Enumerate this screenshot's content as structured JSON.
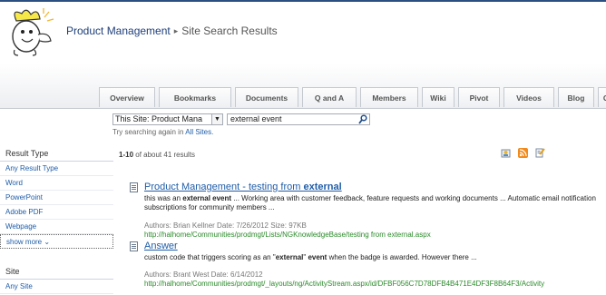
{
  "header": {
    "site_title": "Product Management",
    "breadcrumb_sep": "▸",
    "page_title": "Site Search Results"
  },
  "tabs": [
    "Overview",
    "Bookmarks",
    "Documents",
    "Q and A",
    "Members",
    "Wiki",
    "Pivot",
    "Videos",
    "Blog",
    "Campa"
  ],
  "search": {
    "scope_value": "This Site: Product Mana",
    "query_value": "external event",
    "try_text": "Try searching again in",
    "try_link": "All Sites."
  },
  "leftnav": {
    "result_type_heading": "Result Type",
    "result_type_items": [
      "Any Result Type",
      "Word",
      "PowerPoint",
      "Adobe PDF",
      "Webpage"
    ],
    "show_more": "show more ⌄",
    "site_heading": "Site",
    "site_items": [
      "Any Site"
    ]
  },
  "results_info": {
    "range": "1-10",
    "rest": " of about 41 results"
  },
  "results": [
    {
      "title_pre": "Product Management - testing from ",
      "title_bold": "external",
      "desc_parts": [
        {
          "t": "this was an ",
          "b": false
        },
        {
          "t": "external event",
          "b": true
        },
        {
          "t": " ... Working area with customer feedback, feature requests and working documents ... Automatic email notification subscriptions for community members ...",
          "b": false
        }
      ],
      "meta": "Authors: Brian Kellner   Date: 7/26/2012   Size: 97KB",
      "url": "http://halhome/Communities/prodmgt/Lists/NGKnowledgeBase/testing from external.aspx"
    },
    {
      "title_pre": "Answer",
      "title_bold": "",
      "desc_parts": [
        {
          "t": "custom code that triggers scoring as an \"",
          "b": false
        },
        {
          "t": "external",
          "b": true
        },
        {
          "t": "\" ",
          "b": false
        },
        {
          "t": "event",
          "b": true
        },
        {
          "t": " when the badge is awarded. However there ...",
          "b": false
        }
      ],
      "meta": "Authors: Brant West   Date: 6/14/2012",
      "url": "http://halhome/Communities/prodmgt/_layouts/ng/ActivityStream.aspx/id/DFBF056C7D78DFB4B471E4DF3F8B64F3/Activity"
    }
  ],
  "colors": {
    "link": "#1f5da8",
    "url_green": "#2a8a2a",
    "header_bar": "#2b4f80"
  }
}
